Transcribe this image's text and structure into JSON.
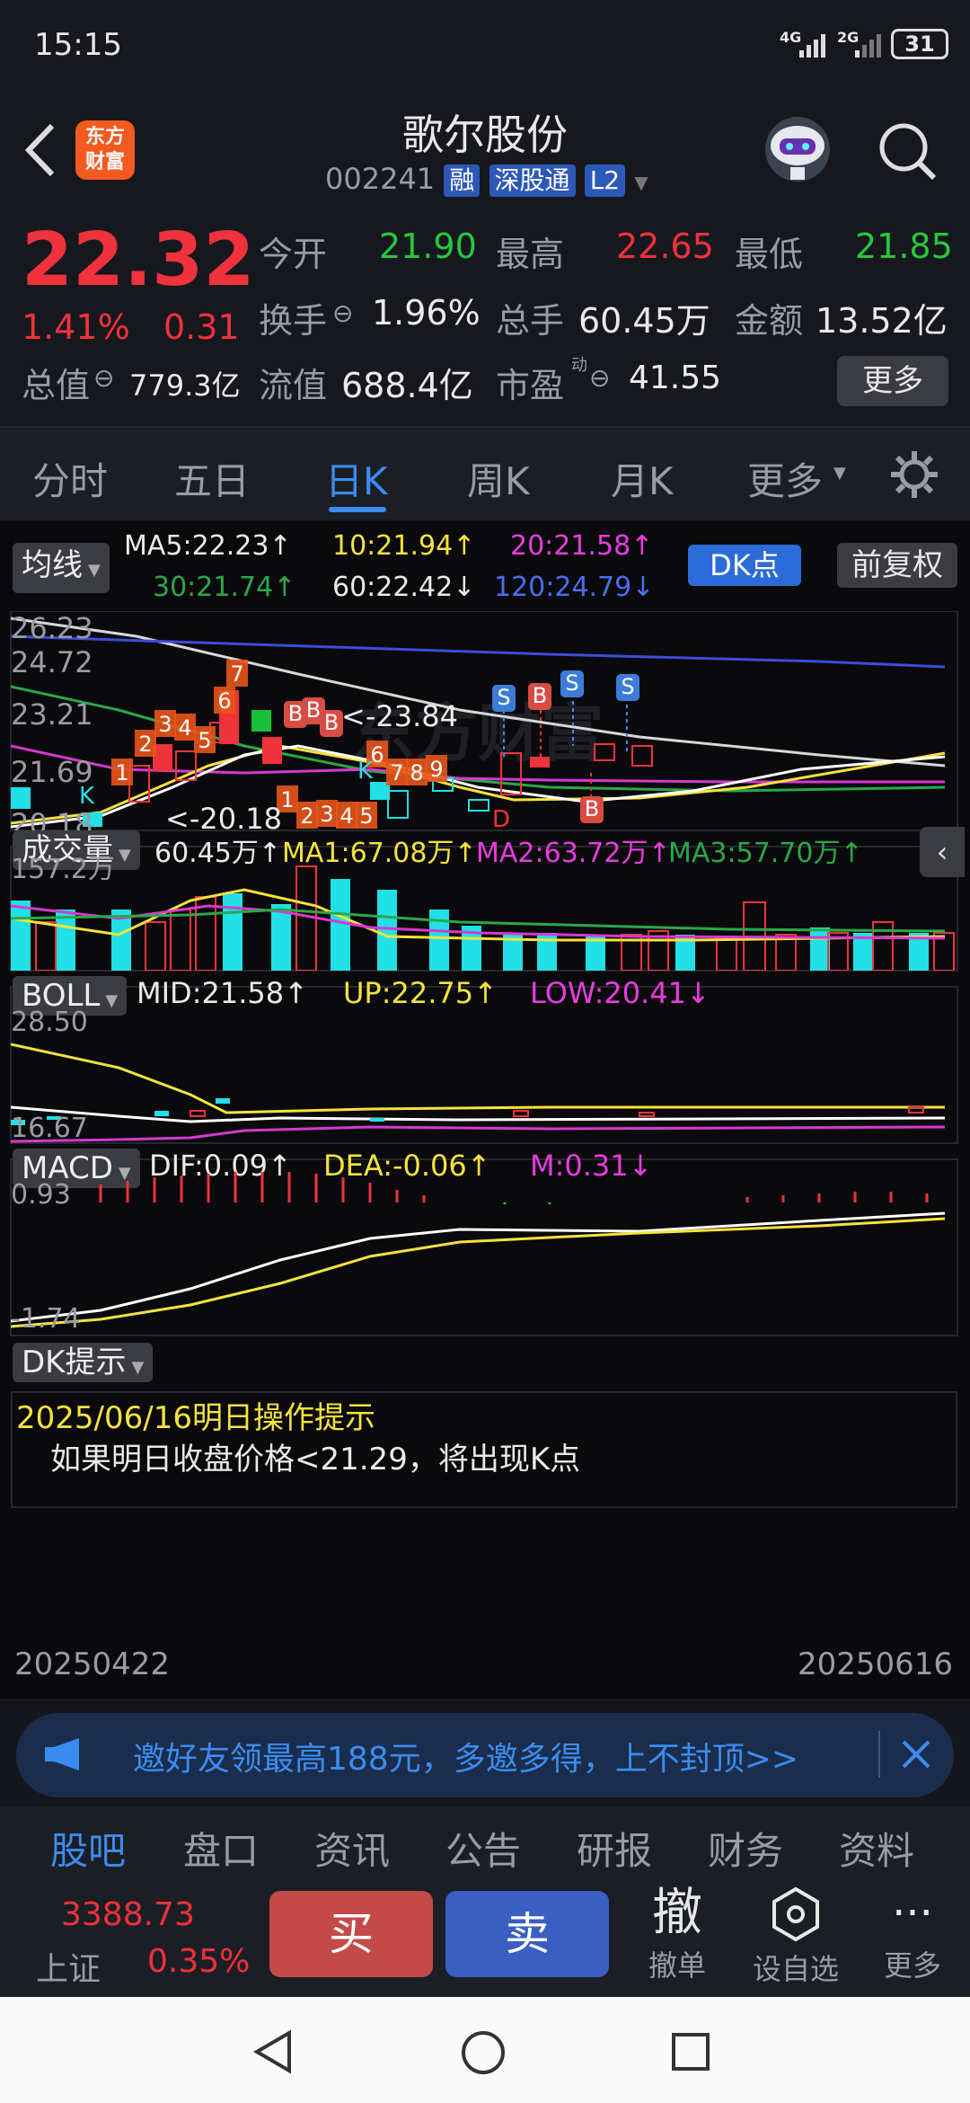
{
  "status": {
    "time": "15:15",
    "net1": "4G",
    "net2": "2G",
    "battery": "31"
  },
  "header": {
    "logo_line1": "东方",
    "logo_line2": "财富",
    "title": "歌尔股份",
    "code": "002241",
    "tags": [
      "融",
      "深股通",
      "L2"
    ]
  },
  "quote": {
    "price": "22.32",
    "pct": "1.41%",
    "chg": "0.31",
    "open_label": "今开",
    "open": "21.90",
    "high_label": "最高",
    "high": "22.65",
    "low_label": "最低",
    "low": "21.85",
    "turnover_label": "换手",
    "turnover": "1.96%",
    "vol_label": "总手",
    "vol": "60.45万",
    "amount_label": "金额",
    "amount": "13.52亿",
    "mktcap_label": "总值",
    "mktcap": "779.3亿",
    "float_label": "流值",
    "float": "688.4亿",
    "pe_label": "市盈",
    "pe_sup": "动",
    "pe": "41.55",
    "more": "更多"
  },
  "tabs": [
    "分时",
    "五日",
    "日K",
    "周K",
    "月K",
    "更多"
  ],
  "ma": {
    "btn": "均线",
    "ma5": "MA5:22.23↑",
    "ma10": "10:21.94↑",
    "ma20": "20:21.58↑",
    "ma30": "30:21.74↑",
    "ma60": "60:22.42↓",
    "ma120": "120:24.79↓",
    "dk": "DK点",
    "fq": "前复权"
  },
  "kchart": {
    "ticks": [
      "26.23",
      "24.72",
      "23.21",
      "21.69",
      "20.18"
    ],
    "hi_label": "<-23.84",
    "lo_label": "<-20.18",
    "watermark": "东方财富"
  },
  "vol": {
    "btn": "成交量",
    "v": "60.45万↑",
    "ma1": "MA1:67.08万↑",
    "ma2": "MA2:63.72万↑",
    "ma3": "MA3:57.70万↑",
    "tick": "157.2万"
  },
  "boll": {
    "btn": "BOLL",
    "mid": "MID:21.58↑",
    "up": "UP:22.75↑",
    "low": "LOW:20.41↓",
    "t1": "28.50",
    "t2": "16.67"
  },
  "macd": {
    "btn": "MACD",
    "dif": "DIF:0.09↑",
    "dea": "DEA:-0.06↑",
    "m": "M:0.31↓",
    "t1": "0.93",
    "t2": "-1.74"
  },
  "dk": {
    "btn": "DK提示",
    "title": "2025/06/16明日操作提示",
    "text": "如果明日收盘价格<21.29，将出现K点"
  },
  "dates": {
    "start": "20250422",
    "end": "20250616"
  },
  "banner": {
    "text": "邀好友领最高188元，多邀多得，上不封顶>>"
  },
  "bottomtabs": [
    "股吧",
    "盘口",
    "资讯",
    "公告",
    "研报",
    "财务",
    "资料"
  ],
  "bottombar": {
    "index_val": "3388.73",
    "index_name": "上证",
    "index_pct": "0.35%",
    "buy": "买",
    "sell": "卖",
    "cancel_glyph": "撤",
    "cancel": "撤单",
    "watch": "设自选",
    "more": "更多"
  }
}
